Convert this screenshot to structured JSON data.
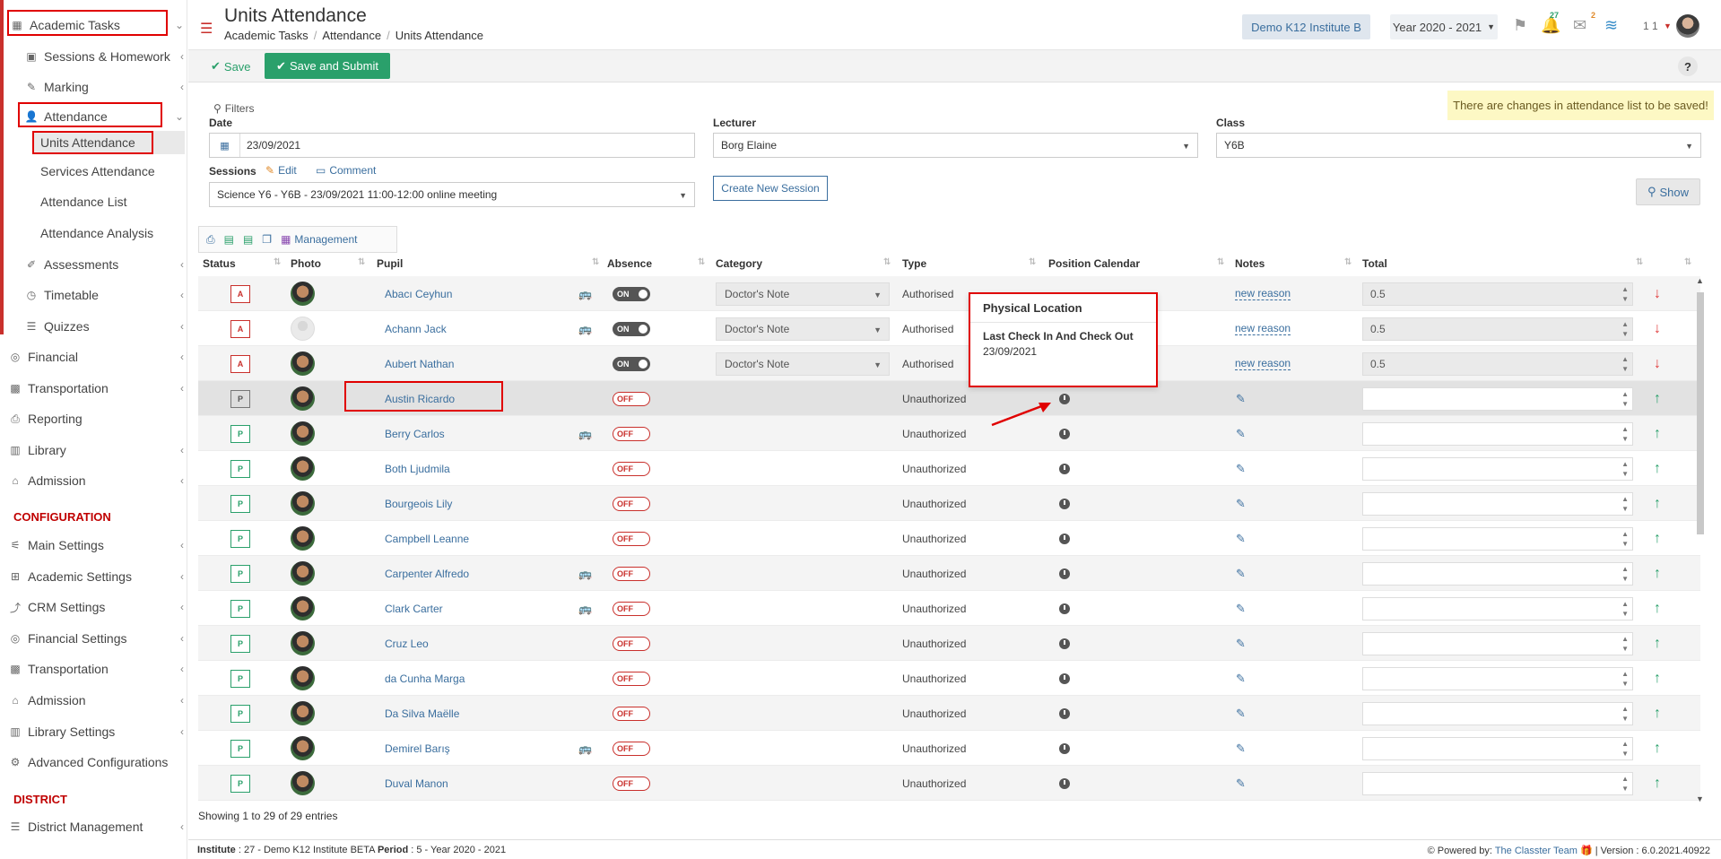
{
  "sidebar": {
    "academic_tasks": "Academic Tasks",
    "sessions_homework": "Sessions & Homework",
    "marking": "Marking",
    "attendance": "Attendance",
    "units_attendance": "Units Attendance",
    "services_attendance": "Services Attendance",
    "attendance_list": "Attendance List",
    "attendance_analysis": "Attendance Analysis",
    "assessments": "Assessments",
    "timetable": "Timetable",
    "quizzes": "Quizzes",
    "financial": "Financial",
    "transportation": "Transportation",
    "reporting": "Reporting",
    "library": "Library",
    "admission": "Admission",
    "configuration_header": "CONFIGURATION",
    "main_settings": "Main Settings",
    "academic_settings": "Academic Settings",
    "crm_settings": "CRM Settings",
    "financial_settings": "Financial Settings",
    "transportation_cfg": "Transportation",
    "admission_cfg": "Admission",
    "library_settings": "Library Settings",
    "advanced_configurations": "Advanced Configurations",
    "district_header": "DISTRICT",
    "district_management": "District Management"
  },
  "header": {
    "title": "Units Attendance",
    "breadcrumb": [
      "Academic Tasks",
      "Attendance",
      "Units Attendance"
    ],
    "institute": "Demo K12 Institute B",
    "year": "Year 2020 - 2021",
    "notifications_count": "27",
    "messages_count": "2",
    "user_label": "1 1"
  },
  "toolbar": {
    "save_label": "Save",
    "save_submit_label": "Save and Submit",
    "help_label": "?"
  },
  "alert": "There are changes in attendance list to be saved!",
  "filters": {
    "title": "Filters",
    "date_label": "Date",
    "date_value": "23/09/2021",
    "lecturer_label": "Lecturer",
    "lecturer_value": "Borg Elaine",
    "class_label": "Class",
    "class_value": "Y6B",
    "sessions_label": "Sessions",
    "edit_label": "Edit",
    "comment_label": "Comment",
    "session_value": "Science Y6 - Y6B - 23/09/2021 11:00-12:00 online meeting",
    "create_session_label": "Create New Session",
    "show_label": "Show"
  },
  "table_toolbar": {
    "management_label": "Management"
  },
  "columns": [
    "Status",
    "Photo",
    "Pupil",
    "Absence",
    "Category",
    "Type",
    "Position Calendar",
    "Notes",
    "Total"
  ],
  "rows": [
    {
      "status": "A",
      "pupil": "Abacı Ceyhun",
      "bus": true,
      "absence": "ON",
      "category": "Doctor's Note",
      "type": "Authorised",
      "note": "new reason",
      "total": "0.5",
      "arrow": "down"
    },
    {
      "status": "A",
      "pupil": "Achann Jack",
      "bus": true,
      "absence": "ON",
      "category": "Doctor's Note",
      "type": "Authorised",
      "note": "new reason",
      "total": "0.5",
      "arrow": "down"
    },
    {
      "status": "A",
      "pupil": "Aubert Nathan",
      "bus": false,
      "absence": "ON",
      "category": "Doctor's Note",
      "type": "Authorised",
      "note": "new reason",
      "total": "0.5",
      "arrow": "down"
    },
    {
      "status": "P",
      "pupil": "Austin Ricardo",
      "bus": false,
      "absence": "OFF",
      "category": "",
      "type": "Unauthorized",
      "note": "",
      "total": "",
      "arrow": "up"
    },
    {
      "status": "P",
      "pupil": "Berry Carlos",
      "bus": true,
      "absence": "OFF",
      "category": "",
      "type": "Unauthorized",
      "note": "",
      "total": "",
      "arrow": "up"
    },
    {
      "status": "P",
      "pupil": "Both Ljudmila",
      "bus": false,
      "absence": "OFF",
      "category": "",
      "type": "Unauthorized",
      "note": "",
      "total": "",
      "arrow": "up"
    },
    {
      "status": "P",
      "pupil": "Bourgeois Lily",
      "bus": false,
      "absence": "OFF",
      "category": "",
      "type": "Unauthorized",
      "note": "",
      "total": "",
      "arrow": "up"
    },
    {
      "status": "P",
      "pupil": "Campbell Leanne",
      "bus": false,
      "absence": "OFF",
      "category": "",
      "type": "Unauthorized",
      "note": "",
      "total": "",
      "arrow": "up"
    },
    {
      "status": "P",
      "pupil": "Carpenter Alfredo",
      "bus": true,
      "absence": "OFF",
      "category": "",
      "type": "Unauthorized",
      "note": "",
      "total": "",
      "arrow": "up"
    },
    {
      "status": "P",
      "pupil": "Clark Carter",
      "bus": true,
      "absence": "OFF",
      "category": "",
      "type": "Unauthorized",
      "note": "",
      "total": "",
      "arrow": "up"
    },
    {
      "status": "P",
      "pupil": "Cruz Leo",
      "bus": false,
      "absence": "OFF",
      "category": "",
      "type": "Unauthorized",
      "note": "",
      "total": "",
      "arrow": "up"
    },
    {
      "status": "P",
      "pupil": "da Cunha Marga",
      "bus": false,
      "absence": "OFF",
      "category": "",
      "type": "Unauthorized",
      "note": "",
      "total": "",
      "arrow": "up"
    },
    {
      "status": "P",
      "pupil": "Da Silva Maëlle",
      "bus": false,
      "absence": "OFF",
      "category": "",
      "type": "Unauthorized",
      "note": "",
      "total": "",
      "arrow": "up"
    },
    {
      "status": "P",
      "pupil": "Demirel Barış",
      "bus": true,
      "absence": "OFF",
      "category": "",
      "type": "Unauthorized",
      "note": "",
      "total": "",
      "arrow": "up"
    },
    {
      "status": "P",
      "pupil": "Duval Manon",
      "bus": false,
      "absence": "OFF",
      "category": "",
      "type": "Unauthorized",
      "note": "",
      "total": "",
      "arrow": "up"
    }
  ],
  "popover": {
    "title": "Physical Location",
    "subtitle": "Last Check In And Check Out",
    "date": "23/09/2021"
  },
  "showing": "Showing 1 to 29 of 29 entries",
  "footer": {
    "institute_label": "Institute",
    "institute_value": ": 27 - Demo K12 Institute BETA",
    "period_label": "Period",
    "period_value": ": 5 - Year 2020 - 2021",
    "powered_label": "Powered by:",
    "powered_link": "The Classter Team",
    "version": "| Version : 6.0.2021.40922"
  },
  "colors": {
    "accent": "#3a6e9e",
    "success": "#2aa06b",
    "danger": "#c9302c",
    "highlight_box": "#e00000"
  }
}
